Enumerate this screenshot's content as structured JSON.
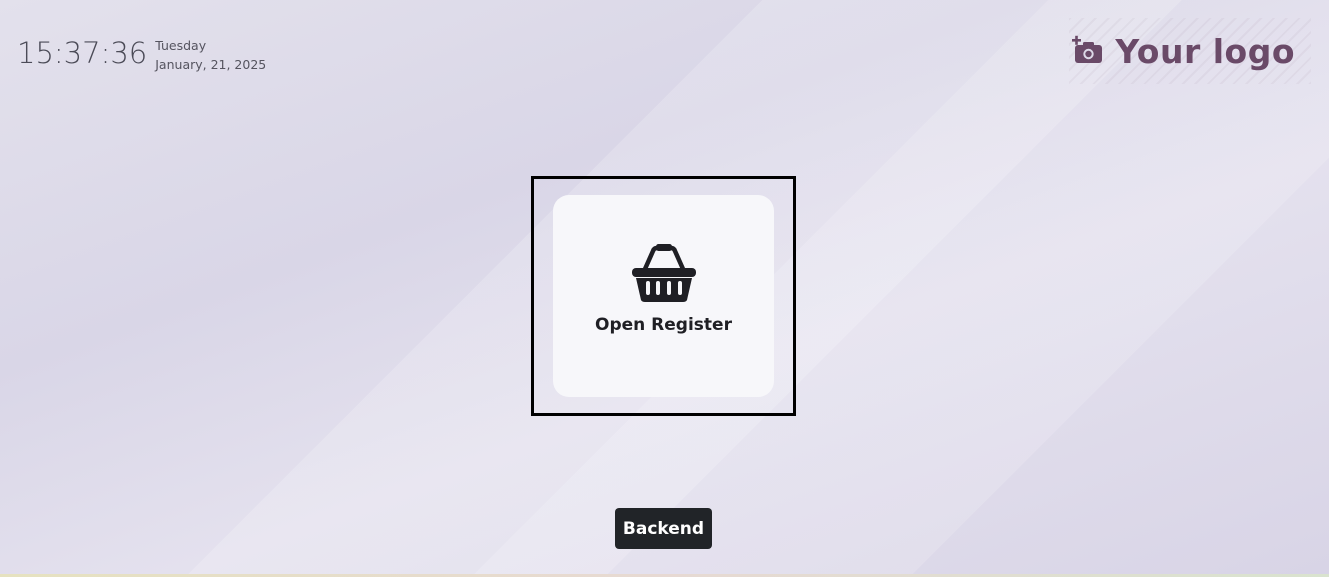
{
  "clock": {
    "time": "15:37:36",
    "weekday": "Tuesday",
    "date": "January, 21, 2025"
  },
  "logo": {
    "text": "Your logo",
    "icon": "camera-plus-icon",
    "color": "#6a4a68"
  },
  "register": {
    "label": "Open Register",
    "icon": "shopping-basket-icon"
  },
  "backend": {
    "label": "Backend"
  }
}
